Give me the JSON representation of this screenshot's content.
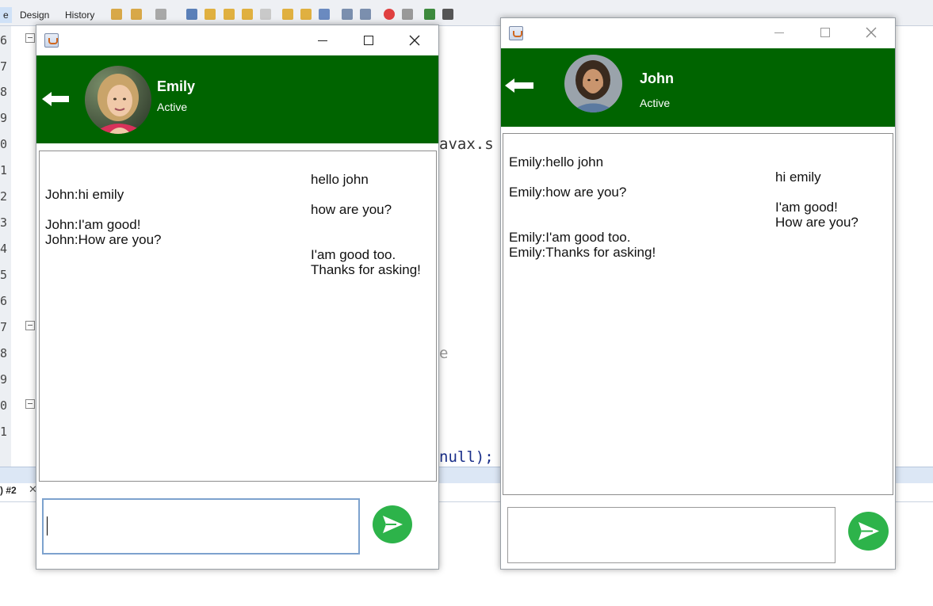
{
  "ide": {
    "tabs": [
      "e",
      "Design",
      "History"
    ],
    "line_numbers": [
      "6",
      "7",
      "8",
      "9",
      "0",
      "1",
      "2",
      "3",
      "4",
      "5",
      "6",
      "7",
      "8",
      "9",
      "0",
      "1"
    ],
    "code_fragments": [
      "avax.s",
      "e",
      "null);"
    ],
    "output_tab": ") #2",
    "output_close": "✕"
  },
  "windows": [
    {
      "id": "emily-window",
      "contact": {
        "name": "Emily",
        "status": "Active"
      },
      "messages_right": [
        "hello john",
        "how are you?",
        "I'am good too.",
        "Thanks for asking!"
      ],
      "messages_left": [
        "John:hi emily",
        "John:I'am good!",
        "John:How are you?"
      ],
      "input": {
        "value": "",
        "placeholder": ""
      }
    },
    {
      "id": "john-window",
      "contact": {
        "name": "John",
        "status": "Active"
      },
      "messages_left": [
        "Emily:hello john",
        "Emily:how are you?",
        "Emily:I'am good too.",
        "Emily:Thanks for asking!"
      ],
      "messages_right": [
        "hi emily",
        "I'am good!",
        "How are you?"
      ],
      "input": {
        "value": "",
        "placeholder": ""
      }
    }
  ],
  "colors": {
    "header_green": "#006400",
    "send_button_green": "#2db34a",
    "text": "#111111"
  },
  "icons": [
    "java-app-icon",
    "minimize-icon",
    "maximize-icon",
    "close-icon",
    "back-arrow-icon",
    "send-icon"
  ]
}
